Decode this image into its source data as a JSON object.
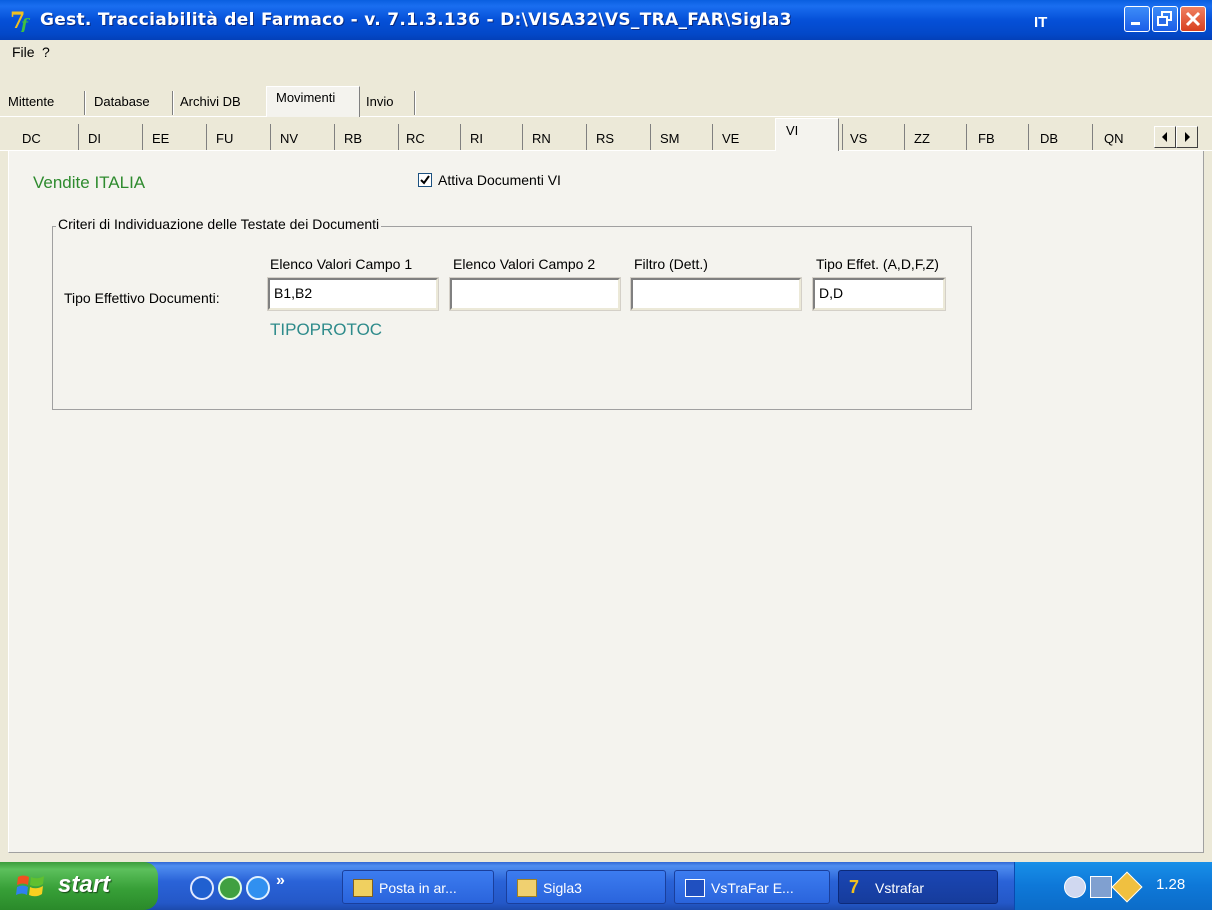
{
  "window": {
    "title": "Gest. Tracciabilità del Farmaco - v.  7.1.3.136 - D:\\VISA32\\VS_TRA_FAR\\Sigla3"
  },
  "menu": [
    "File",
    "?"
  ],
  "main_tabs": [
    "Mittente",
    "Database",
    "Archivi DB",
    "Movimenti",
    "Invio"
  ],
  "main_tabs_active": "Movimenti",
  "sub_tabs": [
    "DC",
    "DI",
    "EE",
    "FU",
    "NV",
    "RB",
    "RC",
    "RI",
    "RN",
    "RS",
    "SM",
    "VE",
    "VI",
    "VS",
    "ZZ",
    "FB",
    "DB",
    "QN"
  ],
  "sub_tabs_active": "VI",
  "panel": {
    "title": "Vendite ITALIA",
    "checkbox_label": "Attiva Documenti VI",
    "checkbox_checked": true,
    "group_title": "Criteri di Individuazione delle Testate dei Documenti",
    "col_headers": [
      "Elenco Valori Campo 1",
      "Elenco Valori Campo 2",
      "Filtro (Dett.)",
      "Tipo Effet. (A,D,F,Z)"
    ],
    "row_label": "Tipo Effettivo Documenti:",
    "fields": [
      "B1,B2",
      "",
      "",
      "D,D"
    ],
    "field_note": "TIPOPROTOC"
  },
  "taskbar": {
    "start_label": "start",
    "buttons": [
      "Posta in ar...",
      "Sigla3",
      "VsTraFar E...",
      "Vstrafar"
    ],
    "active_button": "Vstrafar",
    "language": "IT",
    "clock": "1.28"
  },
  "colors": {
    "title_green": "#2e8b2e",
    "note_teal": "#2e8b8b",
    "titlebar_blue": "#0550d8"
  },
  "icons": [
    "app-icon",
    "minimize-icon",
    "maximize-icon",
    "close-icon",
    "check-icon",
    "scroll-left-icon",
    "scroll-right-icon",
    "windows-flag-icon",
    "outlook-icon",
    "folder-icon",
    "word-icon"
  ]
}
